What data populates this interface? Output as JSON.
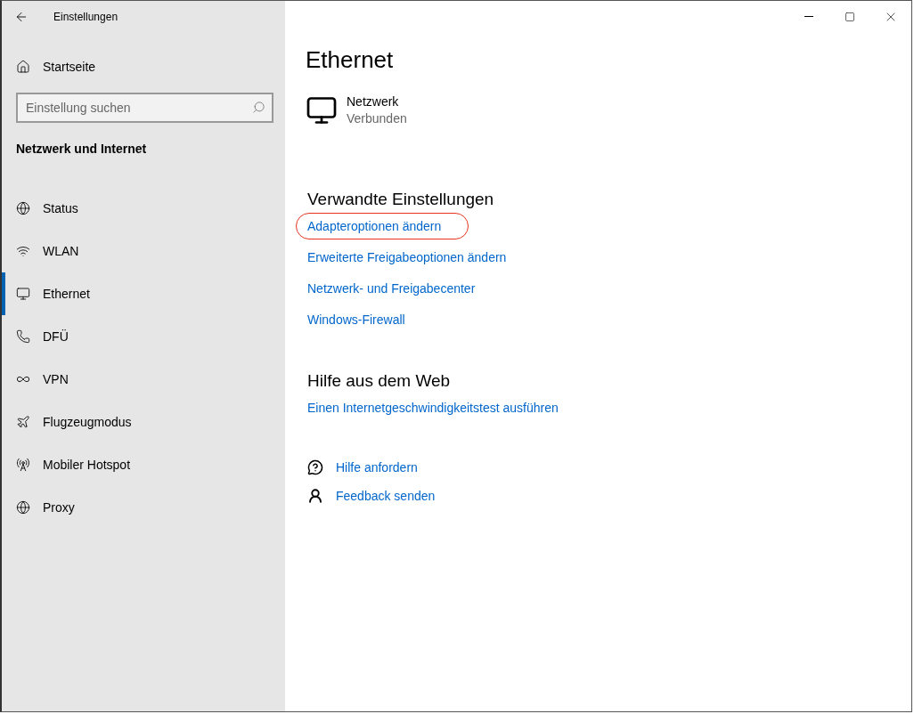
{
  "window": {
    "title": "Einstellungen"
  },
  "sidebar": {
    "home": "Startseite",
    "search": {
      "placeholder": "Einstellung suchen"
    },
    "section": "Netzwerk und Internet",
    "items": [
      {
        "label": "Status",
        "selected": false
      },
      {
        "label": "WLAN",
        "selected": false
      },
      {
        "label": "Ethernet",
        "selected": true
      },
      {
        "label": "DFÜ",
        "selected": false
      },
      {
        "label": "VPN",
        "selected": false
      },
      {
        "label": "Flugzeugmodus",
        "selected": false
      },
      {
        "label": "Mobiler Hotspot",
        "selected": false
      },
      {
        "label": "Proxy",
        "selected": false
      }
    ]
  },
  "page": {
    "title": "Ethernet",
    "network": {
      "name": "Netzwerk",
      "status": "Verbunden"
    },
    "related": {
      "heading": "Verwandte Einstellungen",
      "links": [
        {
          "label": "Adapteroptionen ändern",
          "highlighted": true
        },
        {
          "label": "Erweiterte Freigabeoptionen ändern",
          "highlighted": false
        },
        {
          "label": "Netzwerk- und Freigabecenter",
          "highlighted": false
        },
        {
          "label": "Windows-Firewall",
          "highlighted": false
        }
      ]
    },
    "web_help": {
      "heading": "Hilfe aus dem Web",
      "links": [
        "Einen Internetgeschwindigkeitstest ausführen"
      ]
    },
    "support": [
      "Hilfe anfordern",
      "Feedback senden"
    ]
  }
}
